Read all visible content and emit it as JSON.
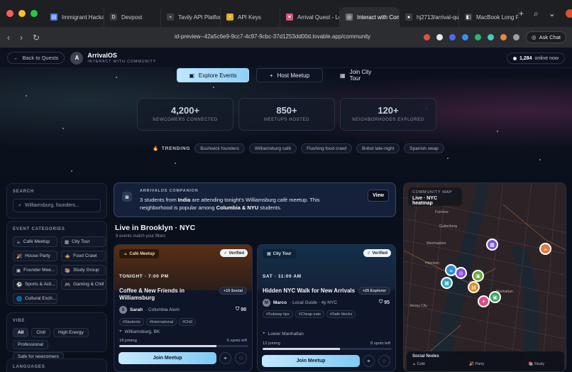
{
  "browser": {
    "tabs": [
      {
        "label": "Immigrant Hackat",
        "color": "#4f7df3",
        "glyph": "▤"
      },
      {
        "label": "Devpost",
        "color": "#3a3d44",
        "glyph": "D"
      },
      {
        "label": "Tavily API Platform",
        "color": "#3a3d44",
        "glyph": "⌁"
      },
      {
        "label": "API Keys",
        "color": "#d8b12b",
        "glyph": "⚡"
      },
      {
        "label": "Arrival Quest - Lov",
        "color": "#d9547c",
        "glyph": "♥"
      },
      {
        "label": "Interact with Com",
        "color": "#6b6f78",
        "glyph": "◎"
      },
      {
        "label": "hj2713/arrival-que",
        "color": "#3a3d44",
        "glyph": "●"
      },
      {
        "label": "MacBook Long Pag",
        "color": "#3a3d44",
        "glyph": "◧"
      }
    ],
    "url": "id-preview--42a5c6e9-9cc7-4c97-9cbc-37d1253dd00d.lovable.app/community",
    "ask_chat": "Ask Chat",
    "new_tab": "+"
  },
  "header": {
    "back": "Back to Quests",
    "logo_letter": "A",
    "brand": "ArrivalOS",
    "subtitle": "INTERACT WITH COMMUNITY",
    "online_count": "1,284",
    "online_suffix": "online now"
  },
  "hero": {
    "buttons": {
      "explore": "Explore Events",
      "host": "Host Meetup",
      "tour": "Join City Tour"
    },
    "stats": [
      {
        "num": "4,200+",
        "label": "NEWCOMERS CONNECTED"
      },
      {
        "num": "850+",
        "label": "MEETUPS HOSTED"
      },
      {
        "num": "120+",
        "label": "NEIGHBORHOODS EXPLORED"
      }
    ],
    "trending_label": "TRENDING",
    "trending": [
      "Bushwick founders",
      "Williamsburg café",
      "Flushing food crawl",
      "Bobst late-night",
      "Spanish swap"
    ]
  },
  "sidebar": {
    "search_title": "SEARCH",
    "search_placeholder": "Williamsburg, founders...",
    "categories_title": "EVENT CATEGORIES",
    "categories": [
      {
        "icon": "☕",
        "label": "Café Meetup"
      },
      {
        "icon": "▦",
        "label": "City Tour"
      },
      {
        "icon": "🎉",
        "label": "House Party"
      },
      {
        "icon": "🍲",
        "label": "Food Crawl"
      },
      {
        "icon": "▣",
        "label": "Founder Mee..."
      },
      {
        "icon": "📚",
        "label": "Study Group"
      },
      {
        "icon": "⚽",
        "label": "Sports & Acti..."
      },
      {
        "icon": "🎮",
        "label": "Gaming & Chill"
      },
      {
        "icon": "🌐",
        "label": "Cultural Exch..."
      }
    ],
    "vibe_title": "VIBE",
    "vibes": [
      "All",
      "Chill",
      "High Energy",
      "Professional",
      "Safe for newcomers"
    ],
    "languages_title": "LANGUAGES"
  },
  "companion": {
    "title": "ARRIVALOS COMPANION",
    "text_a": "3 students from ",
    "country": "India",
    "text_b": " are attending tonight's Williamsburg café meetup. This neighborhood is popular among ",
    "schools": "Columbia & NYU",
    "text_c": " students.",
    "view": "View"
  },
  "live": {
    "title": "Live in Brooklyn · NYC",
    "sub": "9 events match your filters"
  },
  "events": [
    {
      "tag": "Café Meetup",
      "tag_icon": "☕",
      "verified": "Verified",
      "time": "TONIGHT · 7:00 PM",
      "title": "Coffee & New Friends in Williamsburg",
      "badge": "+15 Social",
      "host_initial": "S",
      "host": "Sarah",
      "host_role": "· Columbia Alum",
      "score": "98",
      "tags": [
        "#Students",
        "#International",
        "#Chill"
      ],
      "location": "Williamsburg, BK",
      "joining": "18 joining",
      "spots": "6 spots left",
      "progress": 0.75,
      "join": "Join Meetup"
    },
    {
      "tag": "City Tour",
      "tag_icon": "▦",
      "verified": "Verified",
      "time": "SAT · 11:00 AM",
      "title": "Hidden NYC Walk for New Arrivals",
      "badge": "+25 Explorer",
      "host_initial": "M",
      "host": "Marco",
      "host_role": "· Local Guide · 4y NYC",
      "score": "95",
      "tags": [
        "#Subway tips",
        "#Cheap eats",
        "#Safe blocks"
      ],
      "location": "Lower Manhattan",
      "joining": "12 joining",
      "spots": "8 spots left",
      "progress": 0.6,
      "join": "Join Meetup"
    }
  ],
  "map": {
    "label_title": "COMMUNITY MAP",
    "label_sub": "Live · NYC heatmap",
    "places": [
      "Fairview",
      "Guttenberg",
      "Weehawken",
      "Hoboken",
      "Manhattan",
      "Jersey City"
    ],
    "legend_title": "Social Nodes",
    "legend": [
      "☕ Café",
      "🎉 Party",
      "📚 Study"
    ]
  }
}
